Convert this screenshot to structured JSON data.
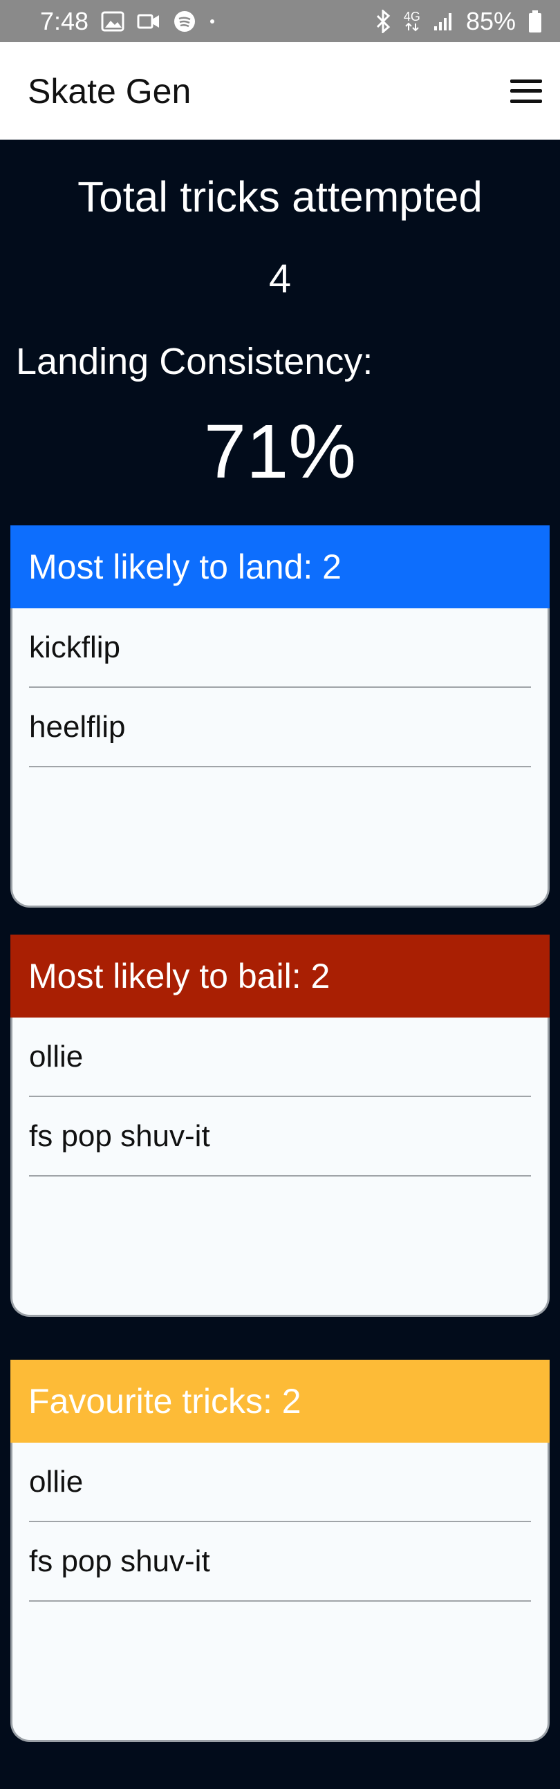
{
  "status": {
    "time": "7:48",
    "battery": "85%",
    "network": "4G"
  },
  "app": {
    "title": "Skate Gen"
  },
  "stats": {
    "title": "Total tricks attempted",
    "count": "4",
    "consistency_label": "Landing Consistency:",
    "consistency_value": "71%"
  },
  "cards": {
    "land": {
      "header": "Most likely to land: 2",
      "color": "#0d6efd",
      "items": [
        "kickflip",
        "heelflip"
      ]
    },
    "bail": {
      "header": "Most likely to bail: 2",
      "color": "#a91f03",
      "items": [
        "ollie",
        "fs pop shuv-it"
      ]
    },
    "favourite": {
      "header": "Favourite tricks: 2",
      "color": "#fdbb37",
      "items": [
        "ollie",
        "fs pop shuv-it"
      ]
    }
  },
  "icons": {
    "status_left": [
      "image-icon",
      "video-icon",
      "spotify-icon",
      "dot-icon"
    ],
    "status_right": [
      "bluetooth-icon",
      "network-4g-icon",
      "signal-icon",
      "battery-icon"
    ],
    "menu": "hamburger-menu-icon"
  }
}
